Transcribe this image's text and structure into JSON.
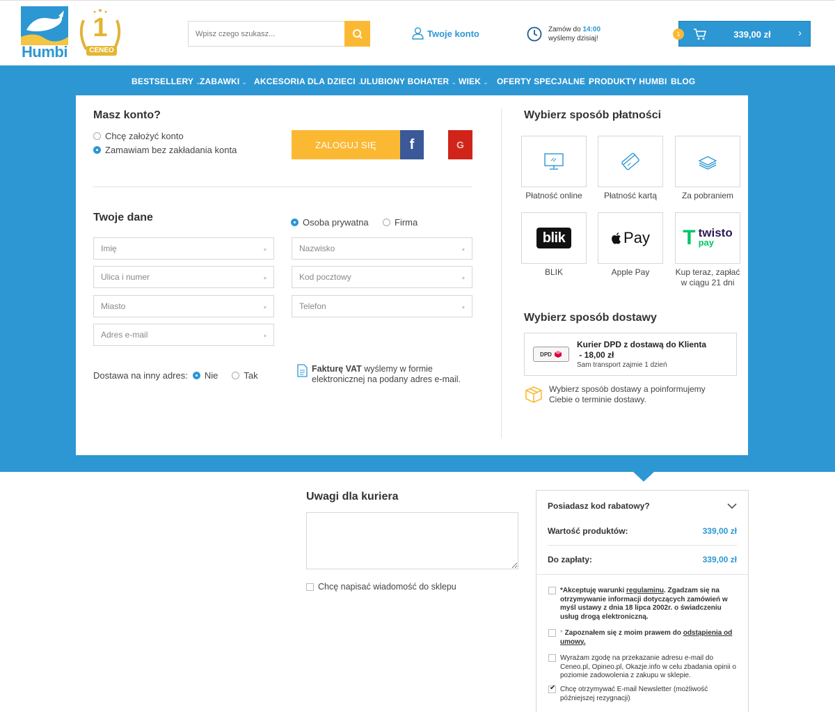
{
  "header": {
    "logo_text": "Humbi",
    "award_number": "1",
    "award_text": "CENEO",
    "search_placeholder": "Wpisz czego szukasz...",
    "account_label": "Twoje konto",
    "order_line1": "Zamów do ",
    "order_time": "14:00",
    "order_line2": "wyślemy dzisiaj!",
    "cart_count": "1",
    "cart_total": "339,00 zł"
  },
  "nav": {
    "items": [
      {
        "label": "BESTSELLERY",
        "caret": "⌄"
      },
      {
        "label": "ZABAWKI",
        "caret": "⌄"
      },
      {
        "label": "AKCESORIA DLA DZIECI",
        "caret": "⌄"
      },
      {
        "label": "ULUBIONY BOHATER",
        "caret": "⌄"
      },
      {
        "label": "WIEK",
        "caret": "⌄"
      },
      {
        "label": "OFERTY SPECJALNE",
        "caret": "⌄"
      },
      {
        "label": "PRODUKTY HUMBI",
        "caret": ""
      },
      {
        "label": "BLOG",
        "caret": ""
      }
    ]
  },
  "account": {
    "title": "Masz konto?",
    "opt_create": "Chcę założyć konto",
    "opt_guest": "Zamawiam bez zakładania konta",
    "login_button": "ZALOGUJ SIĘ",
    "facebook_letter": "f",
    "google_letter": "G"
  },
  "personal": {
    "title": "Twoje dane",
    "type_private": "Osoba prywatna",
    "type_company": "Firma",
    "fields": {
      "first_name": "Imię",
      "last_name": "Nazwisko",
      "street": "Ulica i numer",
      "postcode": "Kod pocztowy",
      "city": "Miasto",
      "phone": "Telefon",
      "email": "Adres e-mail"
    },
    "required_mark": "*",
    "other_address_label": "Dostawa na inny adres:",
    "other_address_no": "Nie",
    "other_address_yes": "Tak",
    "vat_bold": "Fakturę VAT",
    "vat_rest1": " wyślemy w formie",
    "vat_rest2": "elektronicznej na podany adres e-mail."
  },
  "payment": {
    "title": "Wybierz sposób płatności",
    "options": [
      {
        "label": "Płatność online",
        "icon": "monitor-icon"
      },
      {
        "label": "Płatność kartą",
        "icon": "card-icon"
      },
      {
        "label": "Za pobraniem",
        "icon": "cash-icon"
      },
      {
        "label": "BLIK",
        "icon": "blik-logo",
        "logo": "blik"
      },
      {
        "label": "Apple Pay",
        "icon": "apple-pay-logo",
        "logo": "Pay",
        "logo_glyph": ""
      },
      {
        "label1": "Kup teraz, zapłać",
        "label2": "w ciągu 21 dni",
        "icon": "twisto-logo",
        "logo_t": "T",
        "logo_name": "twisto",
        "logo_sub": "pay"
      }
    ]
  },
  "delivery": {
    "title": "Wybierz sposób dostawy",
    "option_name": "Kurier DPD z dostawą do Klienta",
    "option_price": " - 18,00 zł",
    "option_note": "Sam transport zajmie 1 dzień",
    "dpd_logo": "DPD",
    "info1": "Wybierz sposób dostawy a poinformujemy",
    "info2": "Ciebie o terminie dostawy."
  },
  "notes": {
    "title": "Uwagi dla kuriera",
    "message_label": "Chcę napisać wiadomość do sklepu"
  },
  "summary": {
    "discount_label": "Posiadasz kod rabatowy?",
    "products_label": "Wartość produktów:",
    "products_value": "339,00 zł",
    "total_label": "Do zapłaty:",
    "total_value": "339,00 zł",
    "agree1_a": "*Akceptuję warunki ",
    "agree1_link": "regulaminu",
    "agree1_b": ". Zgadzam się na otrzymywanie informacji dotyczących zamówień w myśl ustawy z dnia 18 lipca 2002r. o świadczeniu usług drogą elektroniczną.",
    "agree2_star": "* ",
    "agree2_a": "Zapoznałem się z moim prawem do ",
    "agree2_link": "odstąpienia od umowy.",
    "agree3": "Wyrażam zgodę na przekazanie adresu e-mail do Ceneo.pl, Opineo.pl, Okazje.info w celu zbadania opinii o poziomie zadowolenia z zakupu w sklepie.",
    "agree4": "Chcę otrzymywać E-mail Newsletter (możliwość późniejszej rezygnacji)"
  },
  "colors": {
    "brand_blue": "#2c97d3",
    "accent_yellow": "#fbb933",
    "facebook": "#3b5998",
    "google_red": "#d0241b"
  }
}
